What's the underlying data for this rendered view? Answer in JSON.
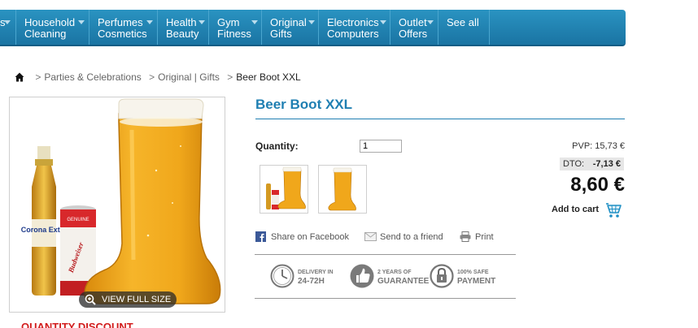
{
  "nav": {
    "items": [
      {
        "line1": "",
        "line2": "s",
        "has_arrow": true
      },
      {
        "line1": "Household",
        "line2": "Cleaning",
        "has_arrow": true
      },
      {
        "line1": "Perfumes",
        "line2": "Cosmetics",
        "has_arrow": true
      },
      {
        "line1": "Health",
        "line2": "Beauty",
        "has_arrow": true
      },
      {
        "line1": "Gym",
        "line2": "Fitness",
        "has_arrow": true
      },
      {
        "line1": "Original",
        "line2": "Gifts",
        "has_arrow": true
      },
      {
        "line1": "Electronics",
        "line2": "Computers",
        "has_arrow": true
      },
      {
        "line1": "Outlet",
        "line2": "Offers",
        "has_arrow": true
      },
      {
        "line1": "See all",
        "line2": "",
        "has_arrow": false
      }
    ]
  },
  "breadcrumb": {
    "sep": ">",
    "items": [
      "Parties & Celebrations",
      "Original | Gifts"
    ],
    "current": "Beer Boot XXL"
  },
  "image": {
    "view_full_label": "VIEW FULL SIZE",
    "can_labels": [
      "GENUINE",
      "Budweiser",
      "Corona Extra"
    ]
  },
  "quantity_discount_label": "QUANTITY DISCOUNT",
  "product": {
    "title": "Beer Boot XXL",
    "quantity_label": "Quantity:",
    "quantity_value": "1",
    "pvp_label": "PVP: 15,73 €",
    "dto_label": "DTO:",
    "dto_value": "-7,13 €",
    "price": "8,60 €",
    "add_to_cart": "Add to cart"
  },
  "share": {
    "facebook": "Share on Facebook",
    "friend": "Send to a friend",
    "print": "Print"
  },
  "guarantees": [
    {
      "small": "DELIVERY IN",
      "big": "24-72H"
    },
    {
      "small": "2 YEARS OF",
      "big": "GUARANTEE"
    },
    {
      "small": "100% SAFE",
      "big": "PAYMENT"
    }
  ],
  "colors": {
    "nav_bg": "#1f82b3",
    "title": "#1f7fb2",
    "discount_red": "#d21c1c",
    "beer": "#f0a71b"
  }
}
